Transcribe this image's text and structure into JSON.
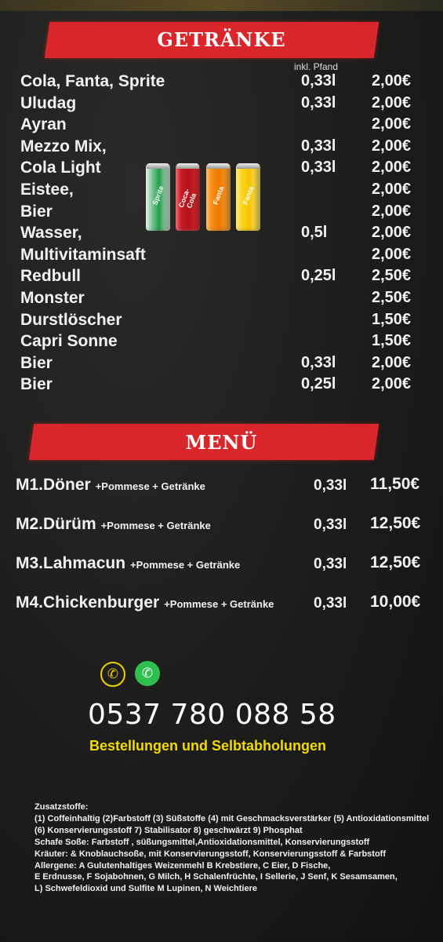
{
  "drinks_section": {
    "title": "GETRÄNKE",
    "pfand_note": "inkl. Pfand",
    "items": [
      {
        "name": "Cola, Fanta, Sprite",
        "volume": "0,33l",
        "price": "2,00€"
      },
      {
        "name": "Uludag",
        "volume": "0,33l",
        "price": "2,00€"
      },
      {
        "name": "Ayran",
        "volume": "",
        "price": "2,00€"
      },
      {
        "name": "Mezzo Mix,",
        "volume": "0,33l",
        "price": "2,00€"
      },
      {
        "name": "Cola Light",
        "volume": "0,33l",
        "price": "2,00€"
      },
      {
        "name": "Eistee,",
        "volume": "",
        "price": "2,00€"
      },
      {
        "name": "Bier",
        "volume": "",
        "price": "2,00€"
      },
      {
        "name": "Wasser,",
        "volume": "0,5l",
        "price": "2,00€"
      },
      {
        "name": "Multivitaminsaft",
        "volume": "",
        "price": "2,00€"
      },
      {
        "name": "Redbull",
        "volume": "0,25l",
        "price": "2,50€"
      },
      {
        "name": "Monster",
        "volume": "",
        "price": "2,50€"
      },
      {
        "name": "Durstlöscher",
        "volume": "",
        "price": "1,50€"
      },
      {
        "name": "Capri Sonne",
        "volume": "",
        "price": "1,50€"
      },
      {
        "name": "Bier",
        "volume": "0,33l",
        "price": "2,00€"
      },
      {
        "name": "Bier",
        "volume": "0,25l",
        "price": "2,00€"
      }
    ],
    "cans": [
      "Sprite",
      "Coca-Cola",
      "Fanta",
      "Fanta"
    ]
  },
  "menu_section": {
    "title": "MENÜ",
    "items": [
      {
        "name": "M1.Döner",
        "extra": "+Pommese + Getränke",
        "volume": "0,33l",
        "price": "11,50€"
      },
      {
        "name": "M2.Dürüm",
        "extra": "+Pommese + Getränke",
        "volume": "0,33l",
        "price": "12,50€"
      },
      {
        "name": "M3.Lahmacun",
        "extra": "+Pommese + Getränke",
        "volume": "0,33l",
        "price": "12,50€"
      },
      {
        "name": "M4.Chickenburger",
        "extra": "+Pommese + Getränke",
        "volume": "0,33l",
        "price": "10,00€"
      }
    ]
  },
  "contact": {
    "phone_icon": "phone-icon",
    "whatsapp_icon": "whatsapp-icon",
    "phone_number": "0537 780 088 58",
    "tagline": "Bestellungen und Selbtabholungen"
  },
  "notes": {
    "lines": [
      "Zusatzstoffe:",
      "(1) Coffeinhaltig (2)Farbstoff (3) Süßstoffe (4) mit Geschmacksverstärker (5) Antioxidationsmittel",
      "(6) Konservierungsstoff 7) Stabilisator 8) geschwärzt 9) Phosphat",
      "Schafe Soße: Farbstoff , süßungsmittel,Antioxidationsmittel, Konservierungsstoff",
      "Kräuter: & Knoblauchsoße, mit Konservierungsstoff, Konservierungsstoff & Farbstoff",
      "Allergene: A Gulutenhaltiges Weizenmehl B Krebstiere, C Eier, D Fische,",
      "E Erdnusse, F Sojabohnen, G Milch, H Schalenfrüchte, I Sellerie, J Senf, K Sesamsamen,",
      "L) Schwefeldioxid und Sulfite M Lupinen, N Weichtiere"
    ]
  },
  "colors": {
    "banner": "#d8262b",
    "tagline": "#f2dc00",
    "background": "#1a1a19"
  }
}
